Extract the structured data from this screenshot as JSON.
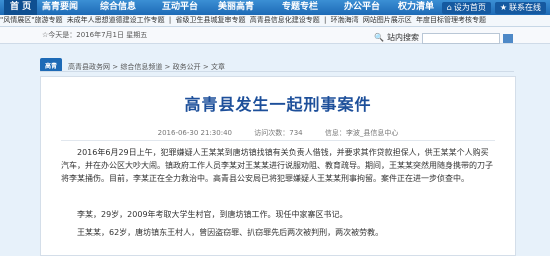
{
  "nav": {
    "items": [
      "首 页",
      "高青要闻",
      "综合信息",
      "互动平台",
      "美丽高青",
      "专题专栏",
      "办公平台",
      "权力清单"
    ],
    "right": {
      "home_label": "设为首页",
      "fav_label": "联系在线"
    }
  },
  "subnav": {
    "items": [
      "\"风情展区\"旅游专题",
      "未成年人思想道德建设工作专题",
      "|",
      "省级卫生县城复审专题",
      "高青县信息化建设专题",
      "|",
      "环渤海湾",
      "网站图片展示区",
      "年度目标管理考核专题"
    ]
  },
  "datebar": {
    "date": "☆今天是：2016年7月1日 星期五",
    "search_label": "站内搜索"
  },
  "logo": {
    "text": "高青"
  },
  "breadcrumb": {
    "text": "高青县政务网 > 综合信息频道 > 政务公开 > 文章"
  },
  "article": {
    "title": "高青县发生一起刑事案件",
    "meta_date": "2016-06-30 21:30:40",
    "meta_visits": "访问次数：734",
    "meta_author": "信息：李波_县信息中心",
    "paragraphs": [
      "2016年6月29日上午，犯罪嫌疑人王某某到唐坊镇找镇有关负责人借钱，并要求其作贷款担保人，供王某某个人购买汽车，并在办公区大吵大闹。镇政府工作人员李某对王某某进行说服劝阻、教育疏导。期间，王某某突然用随身携带的刀子将李某捅伤。目前，李某正在全力救治中。高青县公安局已将犯罪嫌疑人王某某刑事拘留。案件正在进一步侦查中。",
      "李某，29岁，2009年考取大学生村官，到唐坊镇工作。现任中家寨区书记。",
      "王某某，62岁，唐坊镇东王村人，曾因盗窃罪、扒窃罪先后两次被判刑，两次被劳教。"
    ]
  }
}
